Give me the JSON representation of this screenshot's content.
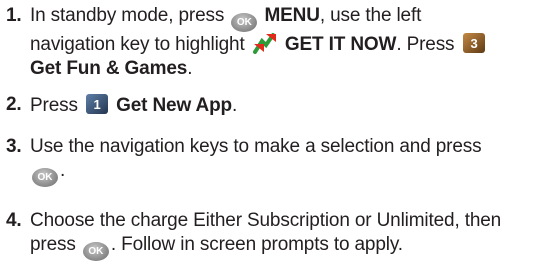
{
  "steps": [
    {
      "number": "1.",
      "line1_a": "In standby mode, press",
      "ok_label": "OK",
      "line1_b": "MENU",
      "line1_c": ", use the left",
      "line2_a": "navigation key to highlight",
      "line2_b": "GET IT NOW",
      "line2_c": ". Press",
      "key3_label": "3",
      "line3_a": "Get Fun & Games",
      "line3_b": "."
    },
    {
      "number": "2.",
      "text_a": "Press",
      "key1_label": "1",
      "text_b": "Get New App",
      "text_c": "."
    },
    {
      "number": "3.",
      "line1": "Use the navigation keys to make a selection and press",
      "ok_label": "OK",
      "line2_end": "."
    },
    {
      "number": "4.",
      "line1": "Choose the charge Either Subscription or Unlimited, then",
      "line2_a": "press",
      "ok_label": "OK",
      "line2_b": ". Follow in screen prompts to apply."
    }
  ],
  "icons": {
    "ok_key": "ok-key-icon",
    "get_it_now": "get-it-now-icon",
    "key3": "key-3-icon",
    "key1": "key-1-icon"
  },
  "colors": {
    "text": "#231f20",
    "ok_key": "#8e8e8e",
    "get_it_now_red": "#e02a1c",
    "get_it_now_green": "#2f9a3a",
    "key_brown": "#8a5a28"
  }
}
